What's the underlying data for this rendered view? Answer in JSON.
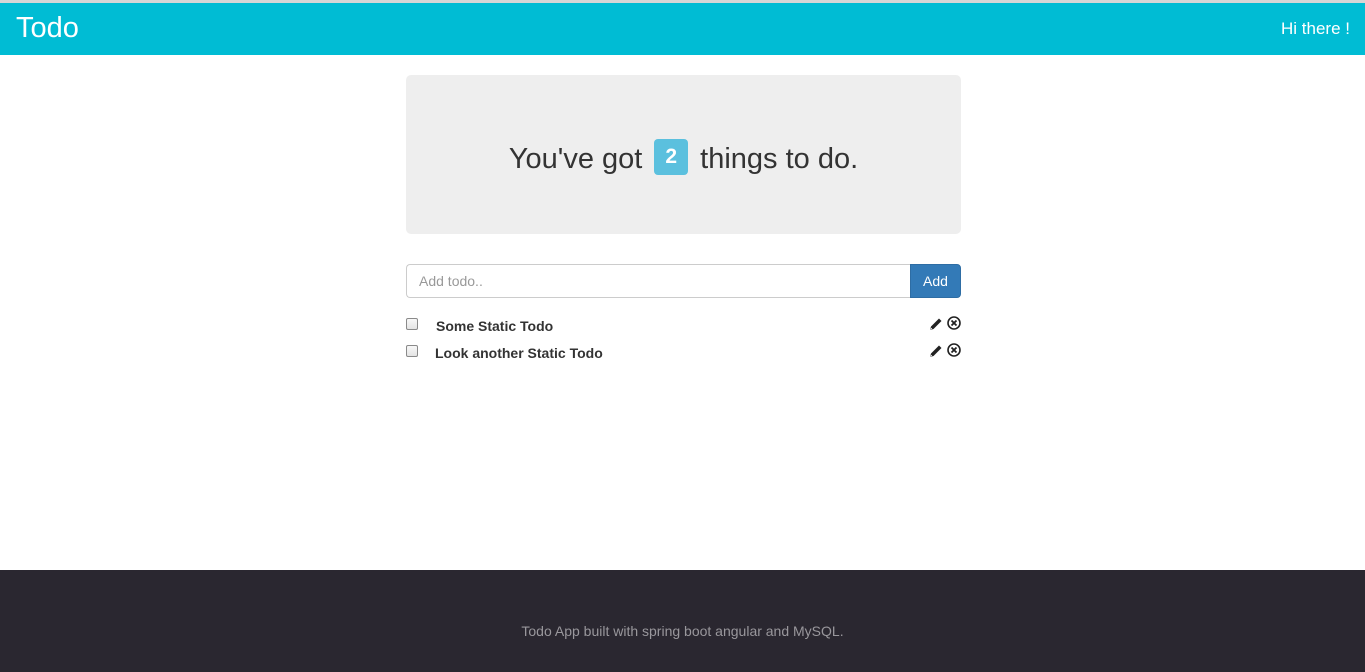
{
  "navbar": {
    "brand": "Todo",
    "greeting": "Hi there !"
  },
  "summary": {
    "prefix": "You've got",
    "count": "2",
    "suffix": "things to do."
  },
  "form": {
    "placeholder": "Add todo..",
    "value": "",
    "add_label": "Add"
  },
  "todos": [
    {
      "label": "Some Static Todo",
      "checked": false
    },
    {
      "label": "Look another Static Todo",
      "checked": false
    }
  ],
  "icons": {
    "edit": "pencil-icon",
    "remove": "circle-x-icon"
  },
  "footer": {
    "text": "Todo App built with spring boot angular and MySQL."
  },
  "colors": {
    "navbar": "#00bcd4",
    "badge": "#5bc0de",
    "add_button": "#337ab7",
    "footer": "#2a2730"
  }
}
